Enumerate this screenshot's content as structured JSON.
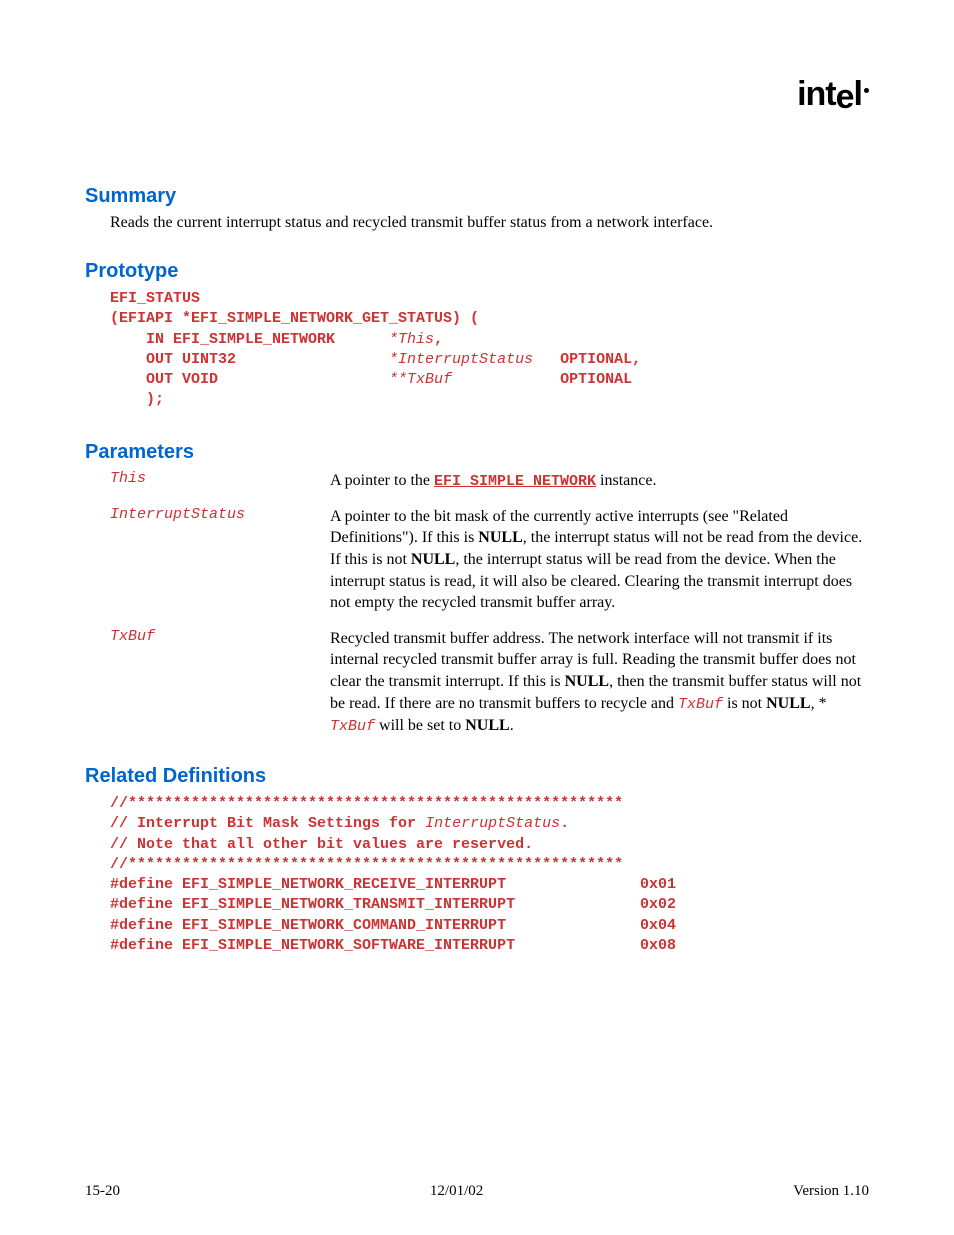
{
  "logo": "intel",
  "headings": {
    "summary": "Summary",
    "prototype": "Prototype",
    "parameters": "Parameters",
    "related": "Related Definitions"
  },
  "summary_text": "Reads the current interrupt status and recycled transmit buffer status from a network interface.",
  "prototype": {
    "l1": "EFI_STATUS",
    "l2": "(EFIAPI *EFI_SIMPLE_NETWORK_GET_STATUS) (",
    "p1_lead": "    IN EFI_SIMPLE_NETWORK      ",
    "p1_arg": "*This",
    "p1_end": ",",
    "p2_lead": "    OUT UINT32                 ",
    "p2_arg": "*InterruptStatus",
    "p2_end": "   OPTIONAL,",
    "p3_lead": "    OUT VOID                   ",
    "p3_arg": "**TxBuf",
    "p3_end": "            OPTIONAL",
    "l_close": "    );"
  },
  "params": {
    "this": {
      "name": "This",
      "d1": "A pointer to the ",
      "link": "EFI_SIMPLE_NETWORK",
      "d2": " instance."
    },
    "istatus": {
      "name": "InterruptStatus",
      "d1": "A pointer to the bit mask of the currently active interrupts (see \"Related Definitions\").  If this is ",
      "null1": "NULL",
      "d2": ", the interrupt status will not be read from the device.  If this is not ",
      "null2": "NULL",
      "d3": ", the interrupt status will be read from the device.  When the interrupt status is read, it will also be cleared.  Clearing the transmit interrupt does not empty the recycled transmit buffer array."
    },
    "txbuf": {
      "name": "TxBuf",
      "d1": "Recycled transmit buffer address.  The network interface will not transmit if its internal recycled transmit buffer array is full.  Reading the transmit buffer does not clear the transmit interrupt.  If this is ",
      "null1": "NULL",
      "d2": ", then the transmit buffer status will not be read.  If there are no transmit buffers to recycle and ",
      "tx1": "TxBuf",
      "d3": " is not ",
      "null2": "NULL",
      "d4": ", * ",
      "tx2": "TxBuf",
      "d5": " will be set to ",
      "null3": "NULL",
      "d6": "."
    }
  },
  "defs": {
    "sep": "//*******************************************************",
    "c1a": "// Interrupt Bit Mask Settings for ",
    "c1b": "InterruptStatus",
    "c1c": ".",
    "c2": "// Note that all other bit values are reserved.",
    "d1n": "#define EFI_SIMPLE_NETWORK_RECEIVE_INTERRUPT",
    "d1v": "0x01",
    "d2n": "#define EFI_SIMPLE_NETWORK_TRANSMIT_INTERRUPT",
    "d2v": "0x02",
    "d3n": "#define EFI_SIMPLE_NETWORK_COMMAND_INTERRUPT",
    "d3v": "0x04",
    "d4n": "#define EFI_SIMPLE_NETWORK_SOFTWARE_INTERRUPT",
    "d4v": "0x08"
  },
  "footer": {
    "left": "15-20",
    "center": "12/01/02",
    "right": "Version 1.10"
  }
}
